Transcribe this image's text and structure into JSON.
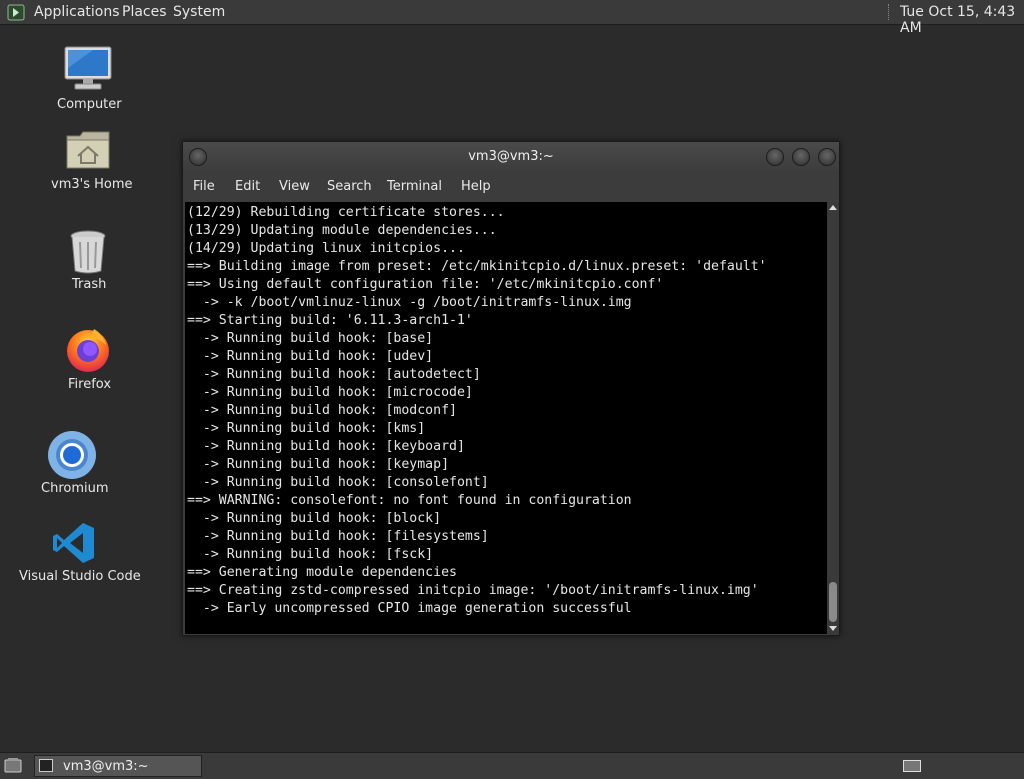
{
  "top_panel": {
    "menus": [
      "Applications",
      "Places",
      "System"
    ],
    "clock": "Tue Oct 15,  4:43 AM"
  },
  "desktop": {
    "icons": [
      {
        "label": "Computer",
        "icon": "computer-icon"
      },
      {
        "label": "vm3's Home",
        "icon": "home-folder-icon"
      },
      {
        "label": "Trash",
        "icon": "trash-icon"
      },
      {
        "label": "Firefox",
        "icon": "firefox-icon"
      },
      {
        "label": "Chromium",
        "icon": "chromium-icon"
      },
      {
        "label": "Visual Studio Code",
        "icon": "vscode-icon"
      }
    ]
  },
  "terminal": {
    "title": "vm3@vm3:~",
    "menu": [
      "File",
      "Edit",
      "View",
      "Search",
      "Terminal",
      "Help"
    ],
    "lines": [
      "(12/29) Rebuilding certificate stores...",
      "(13/29) Updating module dependencies...",
      "(14/29) Updating linux initcpios...",
      "==> Building image from preset: /etc/mkinitcpio.d/linux.preset: 'default'",
      "==> Using default configuration file: '/etc/mkinitcpio.conf'",
      "  -> -k /boot/vmlinuz-linux -g /boot/initramfs-linux.img",
      "==> Starting build: '6.11.3-arch1-1'",
      "  -> Running build hook: [base]",
      "  -> Running build hook: [udev]",
      "  -> Running build hook: [autodetect]",
      "  -> Running build hook: [microcode]",
      "  -> Running build hook: [modconf]",
      "  -> Running build hook: [kms]",
      "  -> Running build hook: [keyboard]",
      "  -> Running build hook: [keymap]",
      "  -> Running build hook: [consolefont]",
      "==> WARNING: consolefont: no font found in configuration",
      "  -> Running build hook: [block]",
      "  -> Running build hook: [filesystems]",
      "  -> Running build hook: [fsck]",
      "==> Generating module dependencies",
      "==> Creating zstd-compressed initcpio image: '/boot/initramfs-linux.img'",
      "  -> Early uncompressed CPIO image generation successful"
    ]
  },
  "bottom_panel": {
    "task_label": "vm3@vm3:~"
  }
}
